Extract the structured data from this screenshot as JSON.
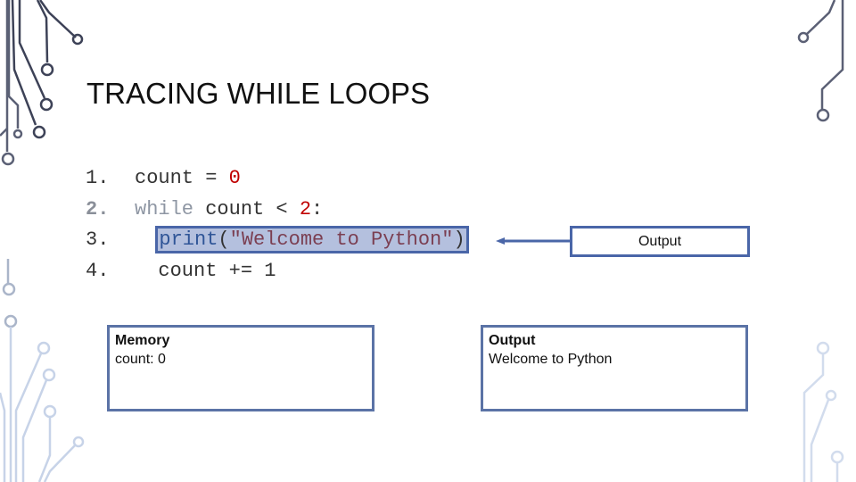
{
  "slide": {
    "title": "TRACING WHILE LOOPS"
  },
  "code": {
    "lines": [
      {
        "number": "1.",
        "indent": "",
        "tokens": [
          "count",
          " = ",
          "0"
        ]
      },
      {
        "number": "2.",
        "indent": "",
        "tokens": [
          "while",
          " count < ",
          "2",
          ":"
        ]
      },
      {
        "number": "3.",
        "indent": "  ",
        "tokens": [
          "print",
          "(",
          "\"Welcome to Python\"",
          ")"
        ]
      },
      {
        "number": "4.",
        "indent": "  ",
        "tokens": [
          "count += 1"
        ]
      }
    ],
    "active_line": 3
  },
  "callout": {
    "label": "Output"
  },
  "memory_panel": {
    "heading": "Memory",
    "entries": [
      "count: 0"
    ]
  },
  "output_panel": {
    "heading": "Output",
    "entries": [
      "Welcome to Python"
    ]
  },
  "colors": {
    "accent": "#4a66a8",
    "highlight": "#b4c0de",
    "number": "#c00000",
    "panel_border": "#5b73a6"
  }
}
